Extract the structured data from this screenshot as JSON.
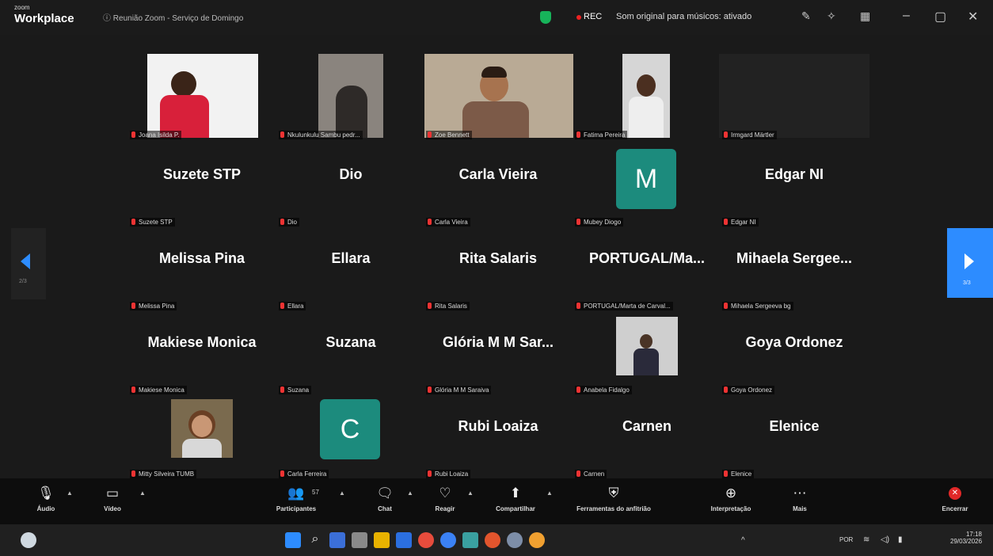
{
  "titlebar": {
    "brand_small": "zoom",
    "brand_big": "Workplace",
    "meeting_title": "Reunião Zoom - Serviço de Domingo",
    "rec_label": "REC",
    "sound_label": "Som original para músicos: ativado",
    "minimize": "–",
    "restore": "▢",
    "close": "✕"
  },
  "colors": {
    "accent": "#2d8cff",
    "avatar_bg": "#1c8b7d",
    "rec": "#e22222",
    "shield": "#17b35a",
    "end": "#e02828"
  },
  "participants": [
    {
      "name": "Joana Isilda P."
    },
    {
      "name": "Nkulunkulu Sambu pedr..."
    },
    {
      "name": "Zoe Bennett"
    },
    {
      "name": "Fatima Pereira"
    },
    {
      "name": "Irmgard Märtler"
    },
    {
      "display": "Suzete STP",
      "name": "Suzete STP"
    },
    {
      "display": "Dio",
      "name": "Dio"
    },
    {
      "display": "Carla Vieira",
      "name": "Carla Vieira"
    },
    {
      "initial": "M",
      "name": "Mubey Diogo"
    },
    {
      "display": "Edgar NI",
      "name": "Edgar NI"
    },
    {
      "display": "Melissa Pina",
      "name": "Melissa Pina"
    },
    {
      "display": "Ellara",
      "name": "Ellara"
    },
    {
      "display": "Rita Salaris",
      "name": "Rita Salaris"
    },
    {
      "display": "PORTUGAL/Ma...",
      "name": "PORTUGAL/Marta de Carval..."
    },
    {
      "display": "Mihaela  Sergee...",
      "name": "Mihaela Sergeeva bg"
    },
    {
      "display": "Makiese Monica",
      "name": "Makiese Monica"
    },
    {
      "display": "Suzana",
      "name": "Suzana"
    },
    {
      "display": "Glória M M Sar...",
      "name": "Glória M M Saraiva"
    },
    {
      "name": "Anabela Fidalgo"
    },
    {
      "display": "Goya Ordonez",
      "name": "Goya Ordonez"
    },
    {
      "name": "Mitty Silveira TUMB"
    },
    {
      "initial": "C",
      "name": "Carla Ferreira"
    },
    {
      "display": "Rubi  Loaiza",
      "name": "Rubi Loaiza"
    },
    {
      "display": "Carnen",
      "name": "Carnen"
    },
    {
      "display": "Elenice",
      "name": "Elenice"
    }
  ],
  "pagination": {
    "left": "2/3",
    "right": "3/3"
  },
  "toolbar": {
    "audio": "Áudio",
    "video": "Vídeo",
    "participants": "Participantes",
    "participants_count": "57",
    "chat": "Chat",
    "react": "Reagir",
    "share": "Compartilhar",
    "host_tools": "Ferramentas do anfitrião",
    "interpretation": "Interpretação",
    "more": "Mais",
    "end": "Encerrar"
  },
  "taskbar": {
    "lang": "POR",
    "time": "17:18",
    "date": "29/03/2026"
  }
}
